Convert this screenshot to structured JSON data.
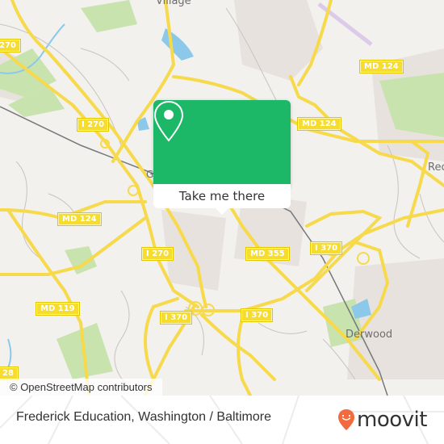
{
  "map": {
    "road_shields": [
      {
        "id": "i270-top",
        "label": "I 270"
      },
      {
        "id": "i270-left-edge",
        "label": "270"
      },
      {
        "id": "md124-ne",
        "label": "MD 124"
      },
      {
        "id": "md124-center",
        "label": "MD 124"
      },
      {
        "id": "md124-west",
        "label": "MD 124"
      },
      {
        "id": "i270-mid",
        "label": "I 270"
      },
      {
        "id": "md355",
        "label": "MD 355"
      },
      {
        "id": "i370-east",
        "label": "I 370"
      },
      {
        "id": "md119",
        "label": "MD 119"
      },
      {
        "id": "i370-west",
        "label": "I 370"
      },
      {
        "id": "i370-south",
        "label": "I 370"
      },
      {
        "id": "md28",
        "label": "28"
      }
    ],
    "place_labels": [
      {
        "id": "village",
        "label": "Village"
      },
      {
        "id": "derwood",
        "label": "Derwood"
      },
      {
        "id": "redland",
        "label": "Rec"
      },
      {
        "id": "gaithersburg-partial",
        "label": "G"
      }
    ],
    "colors": {
      "background": "#f2f1ed",
      "road_major": "#f7d94c",
      "park": "#c8e3ad",
      "water": "#8cc8ea",
      "residential": "#e8e2de"
    }
  },
  "popup": {
    "action_label": "Take me there",
    "icon": "map-pin-icon",
    "color": "#1db867"
  },
  "attribution": {
    "text": "© OpenStreetMap contributors"
  },
  "footer": {
    "title": "Frederick Education, Washington / Baltimore",
    "logo_text": "moovit",
    "logo_icon": "moovit-pin-icon",
    "logo_color": "#f26a3d"
  }
}
